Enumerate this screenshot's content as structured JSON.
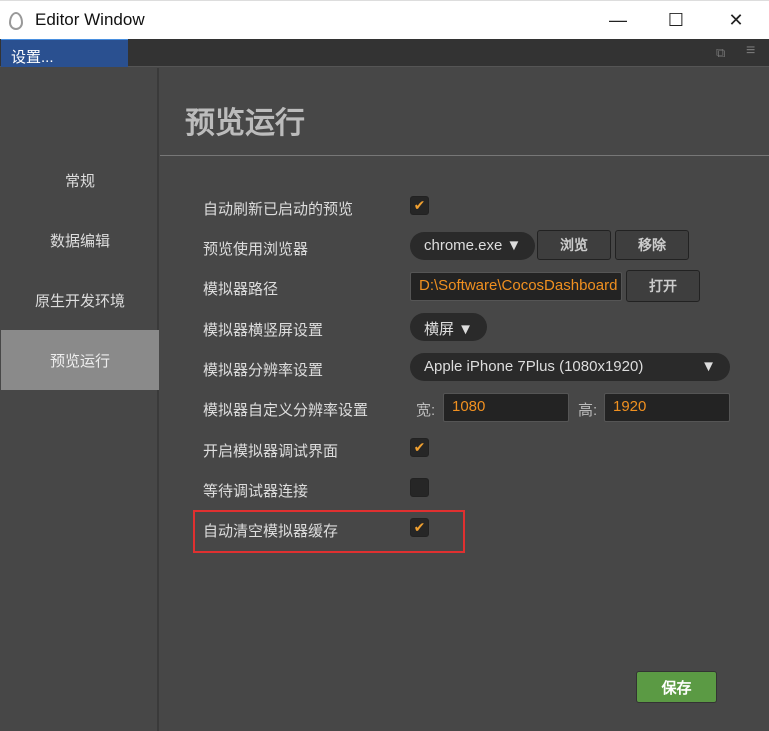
{
  "window": {
    "title": "Editor Window",
    "minimize": "—",
    "maximize": "☐",
    "close": "✕"
  },
  "tab": {
    "label": "设置...",
    "popout_icon": "⧉",
    "menu_icon": "≡"
  },
  "sidebar": {
    "items": [
      {
        "label": "常规"
      },
      {
        "label": "数据编辑"
      },
      {
        "label": "原生开发环境"
      },
      {
        "label": "预览运行"
      }
    ]
  },
  "main": {
    "heading": "预览运行",
    "rows": {
      "auto_refresh": {
        "label": "自动刷新已启动的预览",
        "checked": true
      },
      "browser": {
        "label": "预览使用浏览器",
        "value": "chrome.exe ▼",
        "browse": "浏览",
        "remove": "移除"
      },
      "sim_path": {
        "label": "模拟器路径",
        "value": "D:\\Software\\CocosDashboard",
        "open": "打开"
      },
      "orientation": {
        "label": "模拟器横竖屏设置",
        "value": "横屏 ▼"
      },
      "resolution": {
        "label": "模拟器分辨率设置",
        "value": "Apple iPhone 7Plus (1080x1920)",
        "arrow": "▼"
      },
      "custom_res": {
        "label": "模拟器自定义分辨率设置",
        "width_label": "宽:",
        "width": "1080",
        "height_label": "高:",
        "height": "1920"
      },
      "debug_ui": {
        "label": "开启模拟器调试界面",
        "checked": true
      },
      "wait_debugger": {
        "label": "等待调试器连接",
        "checked": false
      },
      "clear_cache": {
        "label": "自动清空模拟器缓存",
        "checked": true
      }
    },
    "check_mark": "✔",
    "save": "保存"
  }
}
